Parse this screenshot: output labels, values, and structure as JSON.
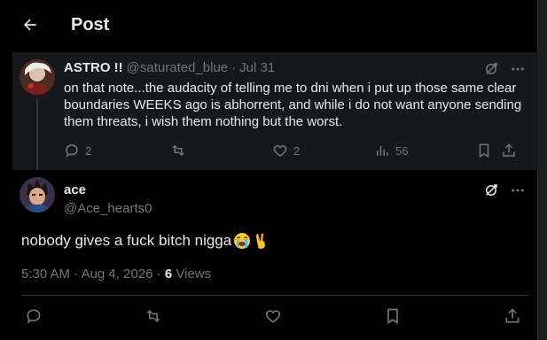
{
  "header": {
    "title": "Post"
  },
  "parent_post": {
    "display_name": "ASTRO !!",
    "handle": "@saturated_blue",
    "separator": "·",
    "date": "Jul 31",
    "text": "on that note...the audacity of telling me to dni when i put up those same clear boundaries WEEKS ago is abhorrent, and while i do not want anyone sending them threats, i wish them nothing but the worst.",
    "replies": "2",
    "reposts": "",
    "likes": "2",
    "views": "56"
  },
  "main_post": {
    "display_name": "ace",
    "handle": "@Ace_hearts0",
    "text": "nobody gives a fuck bitch nigga",
    "emojis": [
      "loudly-crying-face-emoji",
      "victory-hand-emoji"
    ],
    "time": "5:30 AM",
    "separator": "·",
    "date": "Aug 4, 2026",
    "separator2": "·",
    "views_count": "6",
    "views_label": "Views"
  },
  "colors": {
    "background": "#000000",
    "parent_bg": "#16181c",
    "muted": "#71767b",
    "text": "#e7e9ea",
    "divider": "#2f3336"
  }
}
